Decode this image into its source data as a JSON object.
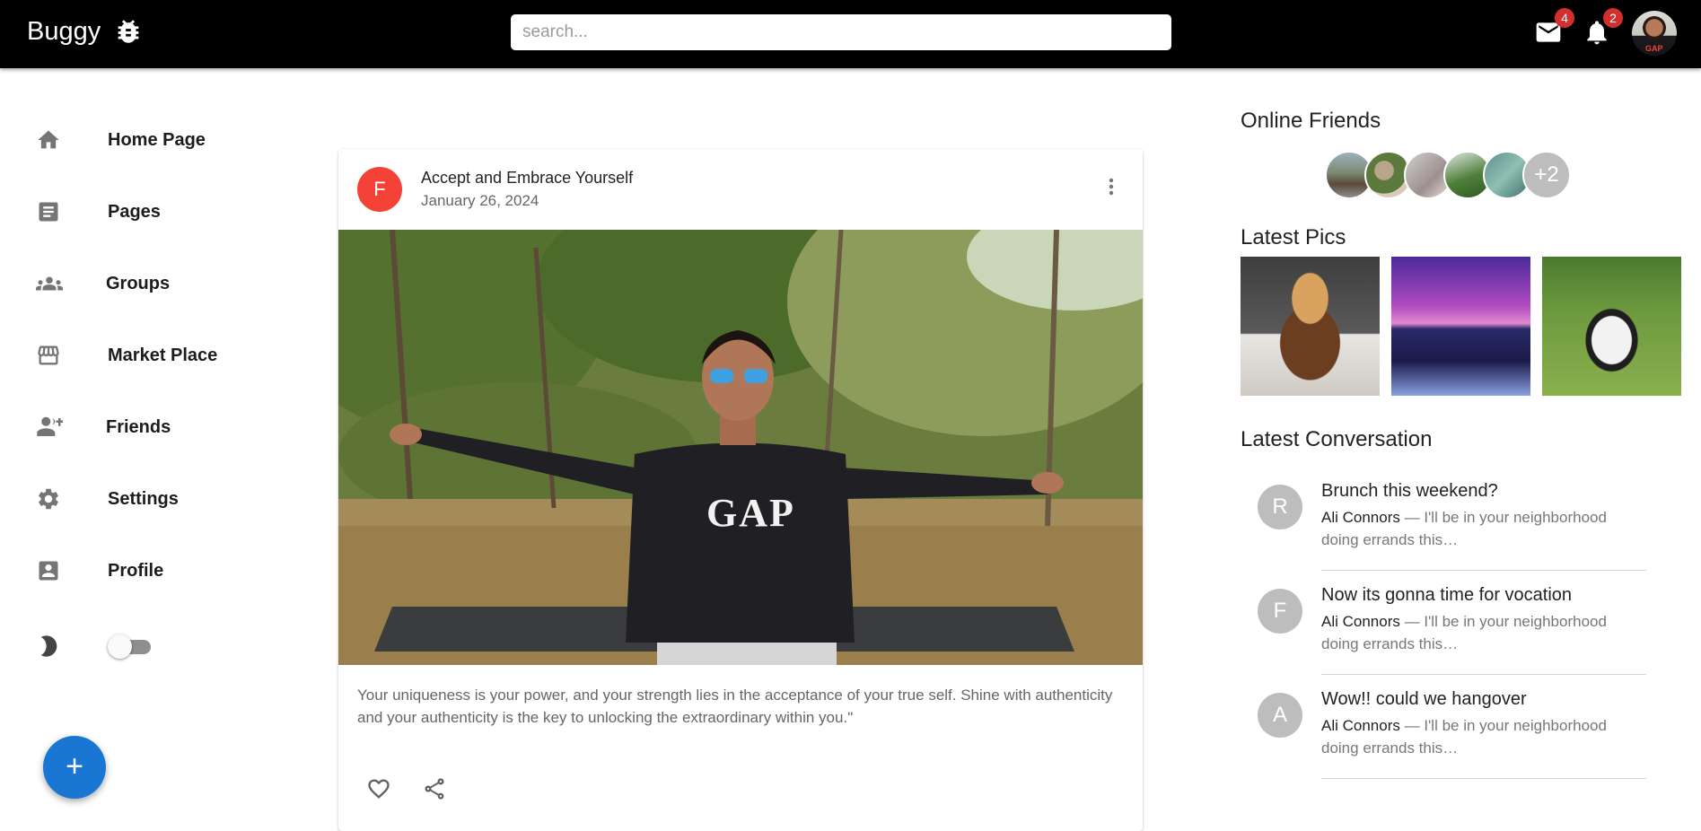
{
  "header": {
    "logo_text": "Buggy",
    "logo_icon": "bug-icon",
    "search_placeholder": "search...",
    "mail_badge": "4",
    "notifications_badge": "2",
    "avatar_text": "GAP"
  },
  "sidebar": {
    "items": [
      {
        "label": "Home Page",
        "icon": "home-icon"
      },
      {
        "label": "Pages",
        "icon": "article-icon"
      },
      {
        "label": "Groups",
        "icon": "groups-icon"
      },
      {
        "label": "Market Place",
        "icon": "storefront-icon"
      },
      {
        "label": "Friends",
        "icon": "person-add-icon"
      },
      {
        "label": "Settings",
        "icon": "gear-icon"
      },
      {
        "label": "Profile",
        "icon": "account-box-icon"
      }
    ],
    "dark_mode_toggle_on": false,
    "fab_label": "+"
  },
  "post": {
    "avatar_letter": "F",
    "title": "Accept and Embrace Yourself",
    "date": "January 26, 2024",
    "shirt_text": "GAP",
    "caption": "Your uniqueness is your power, and your strength lies in the acceptance of your true self. Shine with authenticity and your authenticity is the key to unlocking the extraordinary within you.\""
  },
  "right": {
    "online_friends_title": "Online Friends",
    "online_more": "+2",
    "latest_pics_title": "Latest Pics",
    "latest_conversation_title": "Latest Conversation",
    "conversations": [
      {
        "letter": "R",
        "title": "Brunch this weekend?",
        "sender": "Ali Connors",
        "text": " — I'll be in your neighborhood doing errands this…"
      },
      {
        "letter": "F",
        "title": "Now its gonna time for vocation",
        "sender": "Ali Connors",
        "text": " — I'll be in your neighborhood doing errands this…"
      },
      {
        "letter": "A",
        "title": "Wow!! could we hangover",
        "sender": "Ali Connors",
        "text": " — I'll be in your neighborhood doing errands this…"
      }
    ]
  },
  "colors": {
    "topbar": "#000000",
    "fab": "#1976d2",
    "post_avatar": "#f44336",
    "badge": "#d32f2f"
  }
}
